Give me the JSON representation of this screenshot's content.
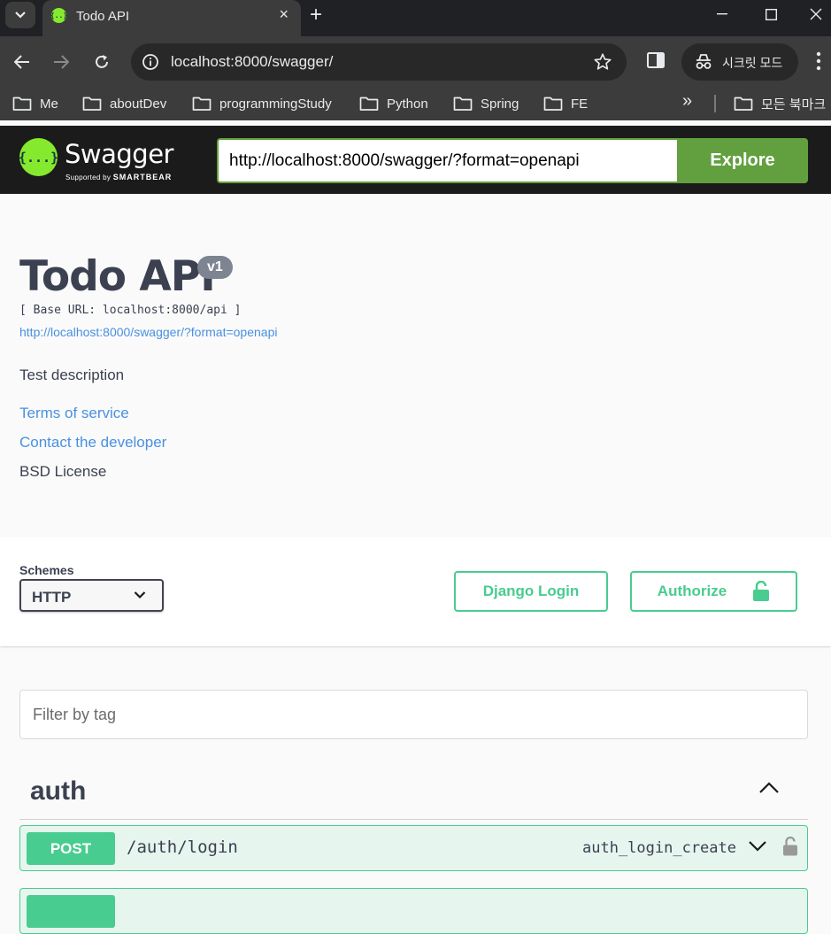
{
  "browser": {
    "tab_title": "Todo API",
    "favicon_glyph": "{..}",
    "new_tab": "+",
    "tab_close": "×",
    "address": "localhost:8000/swagger/",
    "incognito_label": "시크릿 모드",
    "bookmarks": [
      "Me",
      "aboutDev",
      "programmingStudy",
      "Python",
      "Spring",
      "FE"
    ],
    "bookmarks_overflow": "»",
    "all_bookmarks": "모든 북마크"
  },
  "topbar": {
    "logo_glyph": "{...}",
    "logo_word": "Swagger",
    "logo_sub": "Supported by",
    "logo_sub_brand": "SMARTBEAR",
    "spec_url": "http://localhost:8000/swagger/?format=openapi",
    "explore_label": "Explore",
    "accent_color": "#85ea2d",
    "explore_color": "#62a03f"
  },
  "info": {
    "title": "Todo API",
    "version": "v1",
    "base_url": "[ Base URL: localhost:8000/api ]",
    "spec_link": "http://localhost:8000/swagger/?format=openapi",
    "description": "Test description",
    "terms": "Terms of service",
    "contact": "Contact the developer",
    "license": "BSD License"
  },
  "schemes": {
    "label": "Schemes",
    "selected": "HTTP",
    "django_login": "Django Login",
    "authorize": "Authorize",
    "button_color": "#49cc90"
  },
  "operations": {
    "filter_placeholder": "Filter by tag",
    "tags": [
      {
        "name": "auth",
        "ops": [
          {
            "method": "POST",
            "path": "/auth/login",
            "operation_id": "auth_login_create"
          }
        ]
      }
    ]
  }
}
